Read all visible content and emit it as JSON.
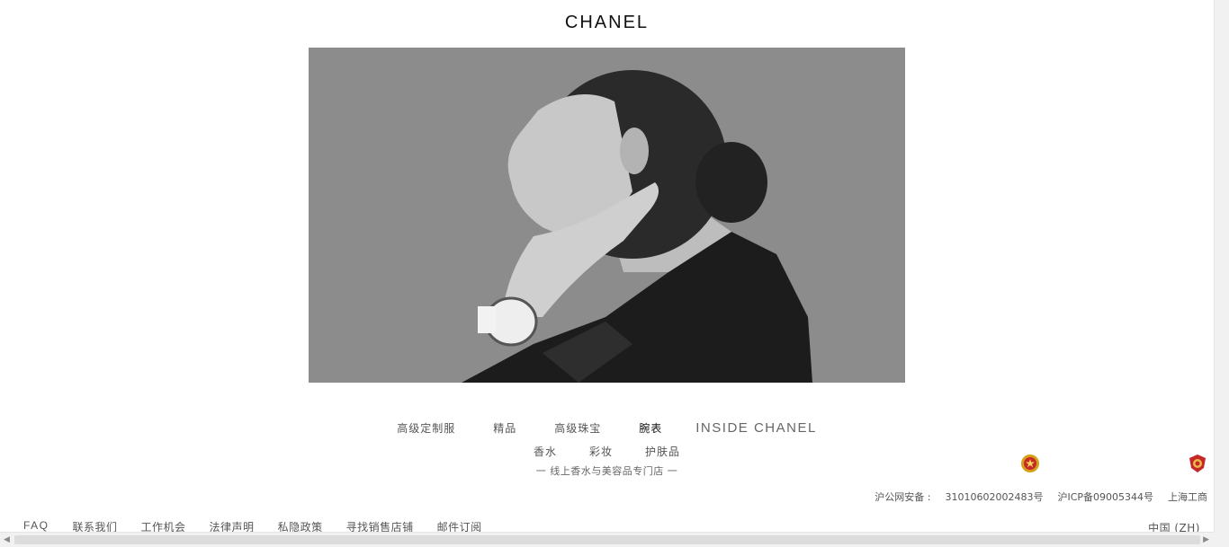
{
  "brand": {
    "logo_text": "CHANEL"
  },
  "nav": {
    "primary": [
      {
        "label": "高级定制服",
        "active": false
      },
      {
        "label": "精品",
        "active": false
      },
      {
        "label": "高级珠宝",
        "active": false
      },
      {
        "label": "腕表",
        "active": true
      },
      {
        "label": "INSIDE CHANEL",
        "active": false
      }
    ],
    "secondary": [
      {
        "label": "香水"
      },
      {
        "label": "彩妆"
      },
      {
        "label": "护肤品"
      }
    ],
    "store_line": "一  线上香水与美容品专门店  一"
  },
  "legal": {
    "police_label": "沪公网安备 :",
    "police_number": "31010602002483号",
    "icp": "沪ICP备09005344号",
    "commerce": "上海工商"
  },
  "footer": {
    "links": [
      "FAQ",
      "联系我们",
      "工作机会",
      "法律声明",
      "私隐政策",
      "寻找销售店铺",
      "邮件订阅"
    ],
    "language": "中国 (ZH)"
  },
  "icons": {
    "police_badge": "police-emblem-icon",
    "commerce_badge": "commerce-emblem-icon"
  }
}
